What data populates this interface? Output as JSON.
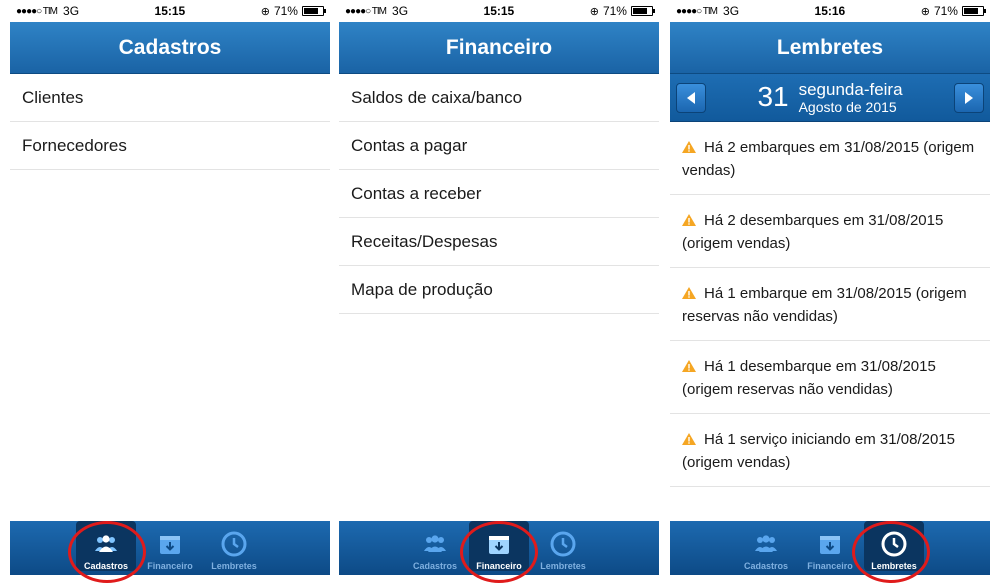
{
  "status": {
    "carrier": "●●●●○ TIM",
    "network": "3G",
    "battery": "71%",
    "times": [
      "15:15",
      "15:15",
      "15:16"
    ]
  },
  "tabs": {
    "cadastros": "Cadastros",
    "financeiro": "Financeiro",
    "lembretes": "Lembretes"
  },
  "screen_cadastros": {
    "title": "Cadastros",
    "items": [
      "Clientes",
      "Fornecedores"
    ]
  },
  "screen_financeiro": {
    "title": "Financeiro",
    "items": [
      "Saldos de caixa/banco",
      "Contas a pagar",
      "Contas a receber",
      "Receitas/Despesas",
      "Mapa de produção"
    ]
  },
  "screen_lembretes": {
    "title": "Lembretes",
    "date_day": "31",
    "date_weekday": "segunda-feira",
    "date_month": "Agosto de 2015",
    "reminders": [
      "Há 2 embarques em 31/08/2015 (origem vendas)",
      "Há 2 desembarques em 31/08/2015 (origem vendas)",
      "Há 1 embarque em 31/08/2015 (origem reservas não vendidas)",
      "Há 1 desembarque em 31/08/2015 (origem reservas não vendidas)",
      "Há 1 serviço iniciando em 31/08/2015 (origem vendas)"
    ]
  },
  "colors": {
    "nav_blue": "#1a63a5",
    "highlight_red": "#e01b1b",
    "warning_orange": "#f5a623"
  }
}
